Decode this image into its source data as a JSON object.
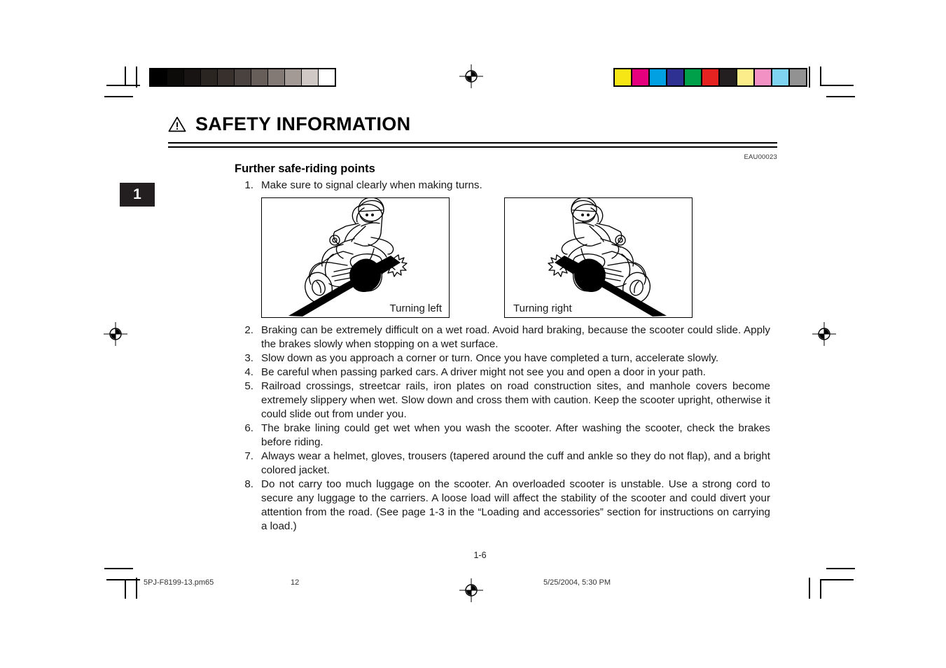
{
  "document": {
    "header": {
      "warning_icon": "warning-triangle-icon",
      "title": "SAFETY INFORMATION",
      "reference_code": "EAU00023"
    },
    "chapter_tab": {
      "number": "1"
    },
    "section": {
      "title": "Further safe-riding points",
      "items": [
        {
          "number": "1.",
          "text": "Make sure to signal clearly when making turns."
        },
        {
          "number": "2.",
          "text": "Braking can be extremely difficult on a wet road. Avoid hard braking, because the scooter could slide. Apply the brakes slowly when stopping on a wet surface."
        },
        {
          "number": "3.",
          "text": "Slow down as you approach a corner or turn. Once you have completed a turn, accelerate slowly."
        },
        {
          "number": "4.",
          "text": "Be careful when passing parked cars. A driver might not see you and open a door in your path."
        },
        {
          "number": "5.",
          "text": "Railroad crossings, streetcar rails, iron plates on road construction sites, and manhole covers become extremely slippery when wet. Slow down and cross them with caution. Keep the scooter upright, otherwise it could slide out from under you."
        },
        {
          "number": "6.",
          "text": "The brake lining could get wet when you wash the scooter. After washing the scooter, check the brakes before riding."
        },
        {
          "number": "7.",
          "text": "Always wear a helmet, gloves, trousers (tapered around the cuff and ankle so they do not flap), and a bright colored jacket."
        },
        {
          "number": "8.",
          "text": "Do not carry too much luggage on the scooter. An overloaded scooter is unstable. Use a strong cord to secure any luggage to the carriers. A loose load will affect the stability of the scooter and could divert your attention from the road. (See page 1-3 in the “Loading and accessories” section for instructions on carrying a load.)"
        }
      ]
    },
    "figures": [
      {
        "name": "scooter-turning-left-illustration",
        "caption": "Turning left"
      },
      {
        "name": "scooter-turning-right-illustration",
        "caption": "Turning right"
      }
    ],
    "folio": {
      "page_number": "1-6"
    },
    "print_footer": {
      "file_name": "5PJ-F8199-13.pm65",
      "sheet_number": "12",
      "timestamp": "5/25/2004, 5:30 PM"
    },
    "prepress": {
      "grayscale_strip": {
        "label": "grayscale-step-wedge",
        "swatches": [
          "#000000",
          "#0d0a0a",
          "#191414",
          "#2b2522",
          "#37302c",
          "#4a423e",
          "#685e59",
          "#847a75",
          "#a39a96",
          "#d0c8c5",
          "#ffffff"
        ]
      },
      "color_strip": {
        "label": "process-color-bar",
        "swatches": [
          "#f7e615",
          "#e5007e",
          "#00a0e2",
          "#2e3192",
          "#00a04a",
          "#e52421",
          "#231f20",
          "#fbee8a",
          "#f291c4",
          "#7fd4f2",
          "#929292"
        ]
      },
      "registration_mark": "registration-target-icon"
    }
  }
}
